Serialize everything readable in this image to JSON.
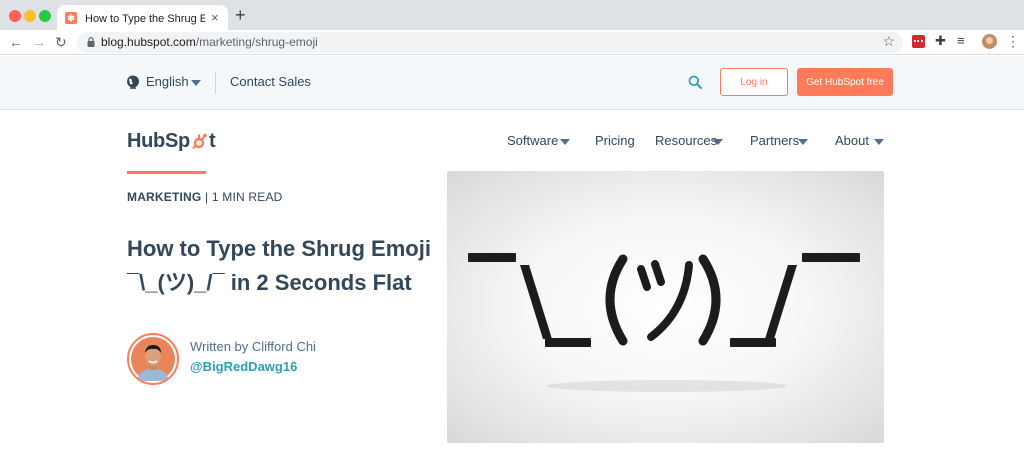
{
  "browser": {
    "tab_title": "How to Type the Shrug Emoji ¯\\_(ツ)_/¯ in 2 Seconds Flat",
    "tab_close": "×",
    "new_tab": "+",
    "url_domain": "blog.hubspot.com",
    "url_path": "/marketing/shrug-emoji"
  },
  "utility": {
    "language": "English",
    "contact": "Contact Sales",
    "login": "Log in",
    "cta": "Get HubSpot free"
  },
  "nav": {
    "logo_pre": "HubSp",
    "logo_post": "t",
    "items": [
      {
        "label": "Software",
        "has_dropdown": true
      },
      {
        "label": "Pricing",
        "has_dropdown": false
      },
      {
        "label": "Resources",
        "has_dropdown": true
      },
      {
        "label": "Partners",
        "has_dropdown": true
      },
      {
        "label": "About",
        "has_dropdown": true
      }
    ]
  },
  "article": {
    "topic": "MARKETING",
    "read_time": "| 1 MIN READ",
    "headline_line1": "How to Type the Shrug Emoji",
    "headline_line2": "¯\\_(ツ)_/¯ in 2 Seconds Flat",
    "author_line": "Written by Clifford Chi",
    "author_handle": "@BigRedDawg16"
  },
  "colors": {
    "brand_orange": "#ff7a59",
    "text_dark": "#33475b",
    "link_teal": "#2c9fb5"
  }
}
